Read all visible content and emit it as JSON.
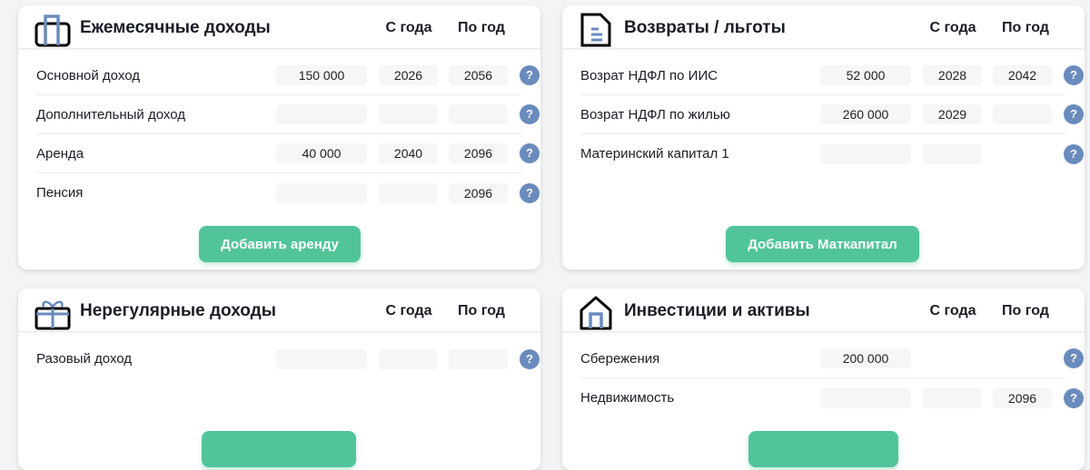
{
  "cards": [
    {
      "title": "Ежемесячные доходы",
      "col_from": "С года",
      "col_to": "По год",
      "button": "Добавить аренду",
      "rows": [
        {
          "label": "Основной доход",
          "value": "150 000",
          "from": "2026",
          "to": "2056"
        },
        {
          "label": "Дополнительный доход",
          "value": "",
          "from": "",
          "to": ""
        },
        {
          "label": "Аренда",
          "value": "40 000",
          "from": "2040",
          "to": "2096"
        },
        {
          "label": "Пенсия",
          "value": "",
          "from": "",
          "to": "2096"
        }
      ]
    },
    {
      "title": "Возвраты / льготы",
      "col_from": "С года",
      "col_to": "По год",
      "button": "Добавить Маткапитал",
      "rows": [
        {
          "label": "Возрат НДФЛ по ИИС",
          "value": "52 000",
          "from": "2028",
          "to": "2042"
        },
        {
          "label": "Возрат НДФЛ по жилью",
          "value": "260 000",
          "from": "2029",
          "to": ""
        },
        {
          "label": "Материнский капитал 1",
          "value": "",
          "from": "",
          "to": null
        }
      ]
    },
    {
      "title": "Нерегулярные доходы",
      "col_from": "С года",
      "col_to": "По год",
      "rows": [
        {
          "label": "Разовый доход",
          "value": "",
          "from": "",
          "to": ""
        }
      ]
    },
    {
      "title": "Инвестиции и активы",
      "col_from": "С года",
      "col_to": "По год",
      "rows": [
        {
          "label": "Сбережения",
          "value": "200 000",
          "from": null,
          "to": null
        },
        {
          "label": "Недвижимость",
          "value": "",
          "from": "",
          "to": "2096"
        }
      ]
    }
  ],
  "help_glyph": "?",
  "colors": {
    "accent": "#52c49a",
    "help": "#6a8bbd"
  }
}
